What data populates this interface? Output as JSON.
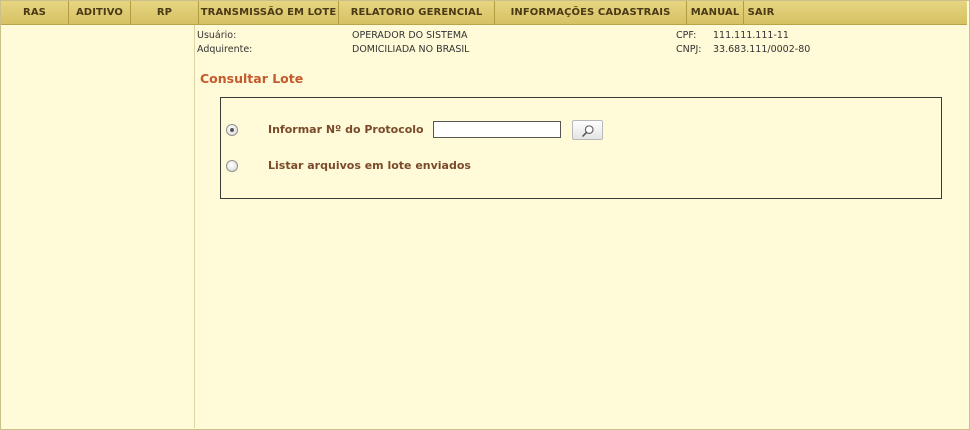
{
  "nav": {
    "items": [
      {
        "label": "RAS"
      },
      {
        "label": "ADITIVO"
      },
      {
        "label": "RP"
      },
      {
        "label": "TRANSMISSÃO EM LOTE"
      },
      {
        "label": "RELATORIO GERENCIAL"
      },
      {
        "label": "INFORMAÇÕES CADASTRAIS"
      },
      {
        "label": "MANUAL"
      },
      {
        "label": "SAIR"
      }
    ]
  },
  "info": {
    "usuario_label": "Usuário:",
    "usuario_value": "OPERADOR DO SISTEMA",
    "adquirente_label": "Adquirente:",
    "adquirente_value": "DOMICILIADA NO BRASIL",
    "cpf_label": "CPF:",
    "cpf_value": "111.111.111-11",
    "cnpj_label": "CNPJ:",
    "cnpj_value": "33.683.111/0002-80"
  },
  "page": {
    "title": "Consultar Lote"
  },
  "form": {
    "option_protocol_label": "Informar Nº do Protocolo",
    "option_list_label": "Listar arquivos em lote enviados",
    "protocol_value": "",
    "selected_option": "protocol"
  },
  "icons": {
    "search_button_icon": "magnifier-icon"
  }
}
